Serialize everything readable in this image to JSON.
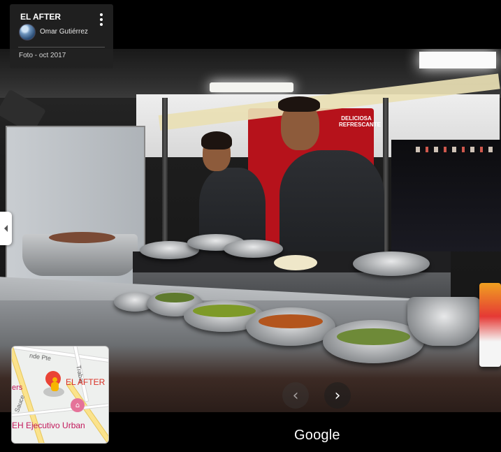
{
  "info_card": {
    "title": "EL AFTER",
    "author": "Omar Gutiérrez",
    "date": "Foto - oct 2017"
  },
  "photo": {
    "sign_text": "DELICIOSA REFRESCANTE"
  },
  "minimap": {
    "place_label": "EL AFTER",
    "hotel_label": "EH Ejecutivo Urban",
    "street_top": "nde Pte",
    "street_left": "Sauce",
    "street_right": "Trabaj",
    "partial_label": "ers"
  },
  "navigation": {
    "prev_symbol": "‹",
    "next_symbol": "›"
  },
  "branding": {
    "logo_text": "Google"
  },
  "icons": {
    "more": "more-vert-icon",
    "collapse": "chevron-left-icon",
    "pin": "map-pin-icon",
    "pegman": "pegman-icon",
    "hotel": "hotel-icon"
  },
  "colors": {
    "pin_red": "#ea4335",
    "hotel_pink": "#c2185b",
    "pegman_yellow": "#f7b500"
  }
}
